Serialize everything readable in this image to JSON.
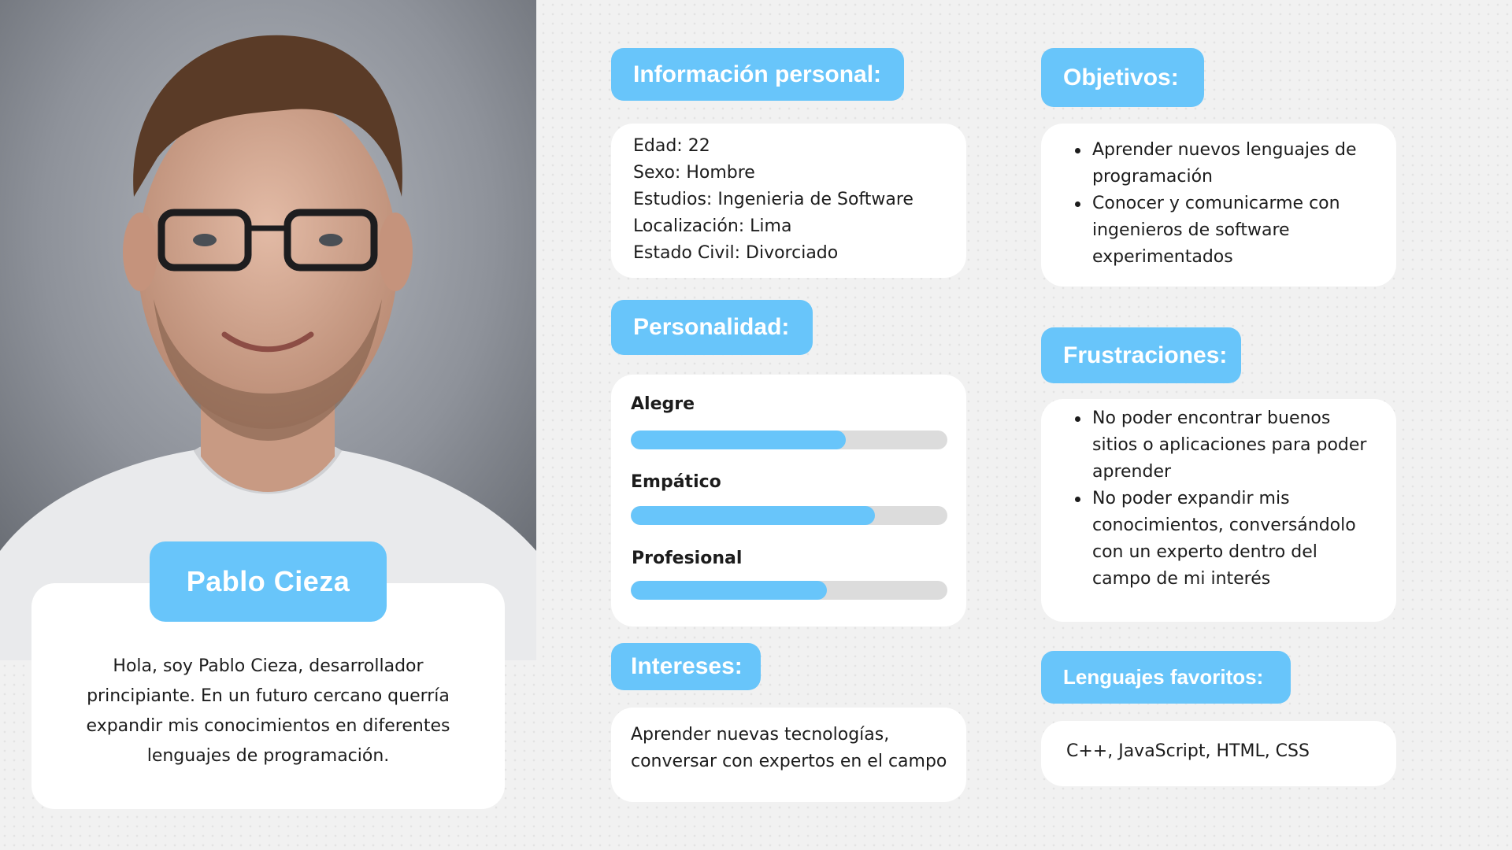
{
  "profile": {
    "name": "Pablo Cieza",
    "bio": "Hola, soy Pablo Cieza, desarrollador principiante. En un futuro cercano querría expandir mis conocimientos en diferentes lenguajes de programación."
  },
  "personal": {
    "title": "Información personal:",
    "lines": [
      "Edad: 22",
      "Sexo: Hombre",
      "Estudios: Ingenieria de Software",
      "Localización: Lima",
      "Estado Civil: Divorciado"
    ]
  },
  "personality": {
    "title": "Personalidad:",
    "traits": [
      {
        "label": "Alegre",
        "level": 0.68
      },
      {
        "label": "Empático",
        "level": 0.77
      },
      {
        "label": "Profesional",
        "level": 0.62
      }
    ]
  },
  "interests": {
    "title": "Intereses:",
    "text": "Aprender nuevas tecnologías, conversar con expertos en el campo"
  },
  "goals": {
    "title": "Objetivos:",
    "items": [
      "Aprender nuevos lenguajes de programación",
      "Conocer y comunicarme con ingenieros de software experimentados"
    ]
  },
  "frustrations": {
    "title": "Frustraciones:",
    "items": [
      "No poder encontrar buenos sitios o aplicaciones para poder aprender",
      "No poder expandir mis conocimientos, conversándolo con un experto dentro del campo de mi interés"
    ]
  },
  "languages": {
    "title": "Lenguajes favoritos:",
    "text": "C++, JavaScript, HTML, CSS"
  },
  "colors": {
    "accent": "#68c5fa",
    "bar_track": "#dcdcdc",
    "card": "#ffffff"
  }
}
